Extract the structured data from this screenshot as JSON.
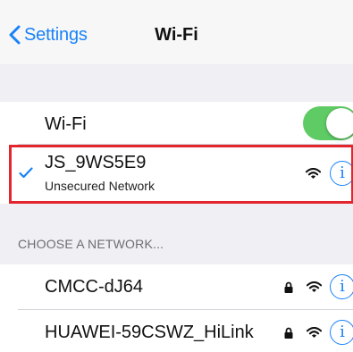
{
  "nav": {
    "back_label": "Settings",
    "title": "Wi-Fi"
  },
  "wifi_toggle": {
    "label": "Wi-Fi",
    "state": "on",
    "on_color": "#5fcb64"
  },
  "connected_network": {
    "name": "JS_9WS5E9",
    "status": "Unsecured Network",
    "icons": [
      "checkmark-icon",
      "wifi-signal-icon",
      "info-icon"
    ]
  },
  "section_header": "CHOOSE A NETWORK...",
  "networks": [
    {
      "name": "CMCC-dJ64",
      "secured": true,
      "icons": [
        "lock-icon",
        "wifi-signal-icon",
        "info-icon"
      ]
    },
    {
      "name": "HUAWEI-59CSWZ_HiLink",
      "secured": true,
      "icons": [
        "lock-icon",
        "wifi-signal-icon",
        "info-icon"
      ]
    }
  ],
  "info_glyph": "i",
  "colors": {
    "accent": "#1a82f7",
    "highlight": "#e3262d",
    "group_background": "#efeff4"
  }
}
